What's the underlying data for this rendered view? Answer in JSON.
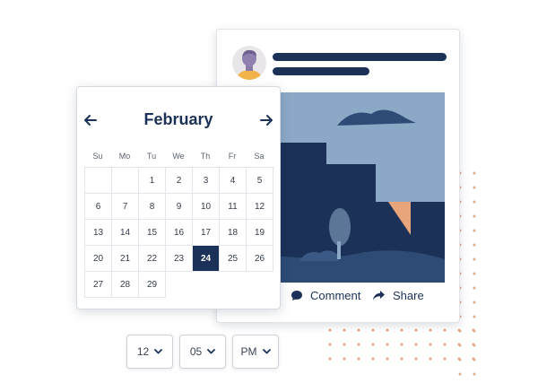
{
  "calendar": {
    "month": "February",
    "weekdays": [
      "Su",
      "Mo",
      "Tu",
      "We",
      "Th",
      "Fr",
      "Sa"
    ],
    "weeks": [
      [
        "",
        "",
        "1",
        "2",
        "3",
        "4",
        "5"
      ],
      [
        "6",
        "7",
        "8",
        "9",
        "10",
        "11",
        "12"
      ],
      [
        "13",
        "14",
        "15",
        "16",
        "17",
        "18",
        "19"
      ],
      [
        "20",
        "21",
        "22",
        "23",
        "24",
        "25",
        "26"
      ],
      [
        "27",
        "28",
        "29",
        "",
        "",
        "",
        ""
      ]
    ],
    "selected_day": "24",
    "icons": {
      "prev": "arrow-left-icon",
      "next": "arrow-right-icon"
    }
  },
  "post": {
    "comment_label": "Comment",
    "share_label": "Share",
    "icons": {
      "comment": "comment-icon",
      "share": "share-icon",
      "avatar": "user-avatar-icon"
    }
  },
  "time": {
    "hour": "12",
    "minute": "05",
    "period": "PM",
    "dropdown_icon": "chevron-down-icon"
  },
  "colors": {
    "navy": "#1b3157",
    "sky": "#8ba9c6",
    "accent_orange": "#e2a884",
    "selected_day": "#1b3157"
  }
}
